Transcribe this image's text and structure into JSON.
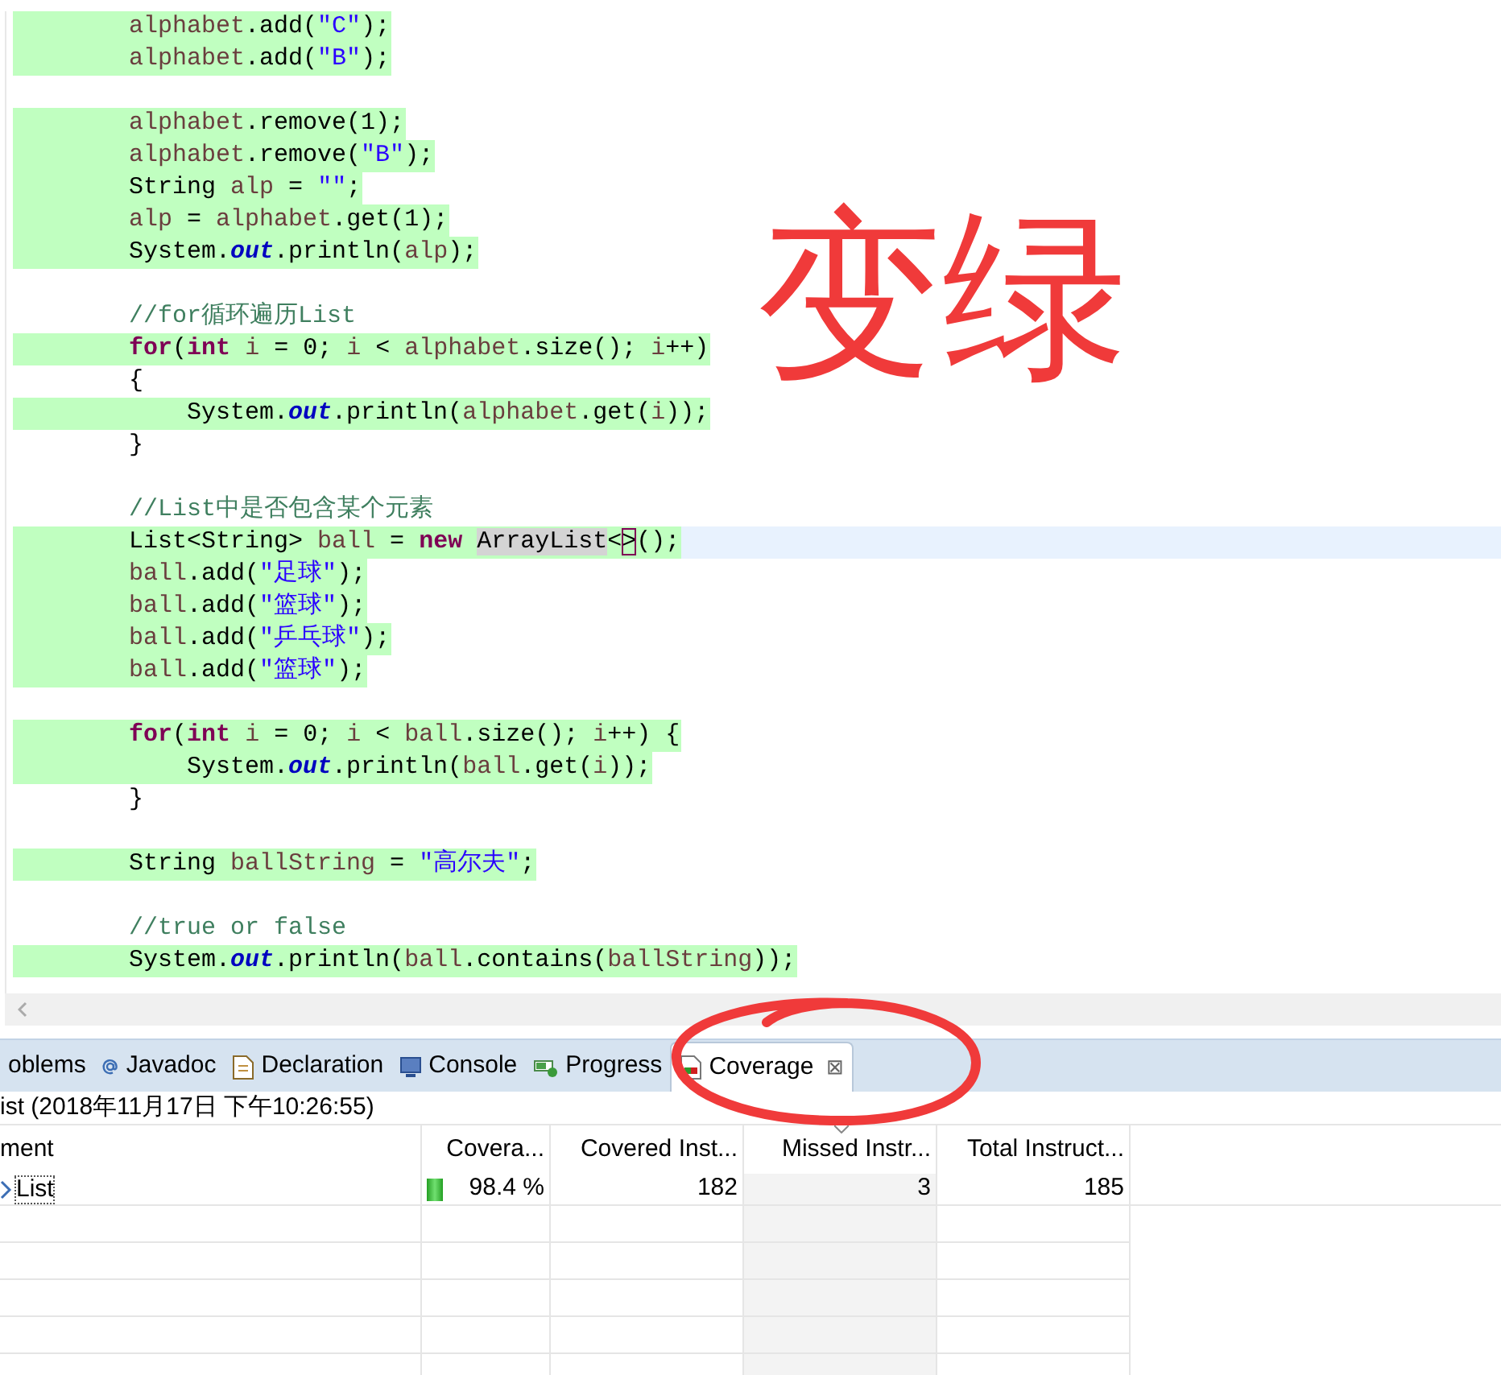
{
  "editor": {
    "lines": [
      {
        "covered": true,
        "tokens": [
          {
            "kind": "var",
            "text": "        alphabet"
          },
          {
            "kind": "plain",
            "text": ".add("
          },
          {
            "kind": "string",
            "text": "\"C\""
          },
          {
            "kind": "plain",
            "text": ");"
          }
        ]
      },
      {
        "covered": true,
        "tokens": [
          {
            "kind": "var",
            "text": "        alphabet"
          },
          {
            "kind": "plain",
            "text": ".add("
          },
          {
            "kind": "string",
            "text": "\"B\""
          },
          {
            "kind": "plain",
            "text": ");"
          }
        ]
      },
      {
        "covered": true,
        "gap_before": true,
        "tokens": [
          {
            "kind": "var",
            "text": "        alphabet"
          },
          {
            "kind": "plain",
            "text": ".remove(1);"
          }
        ]
      },
      {
        "covered": true,
        "tokens": [
          {
            "kind": "var",
            "text": "        alphabet"
          },
          {
            "kind": "plain",
            "text": ".remove("
          },
          {
            "kind": "string",
            "text": "\"B\""
          },
          {
            "kind": "plain",
            "text": ");"
          }
        ]
      },
      {
        "covered": true,
        "tokens": [
          {
            "kind": "plain",
            "text": "        String "
          },
          {
            "kind": "var",
            "text": "alp"
          },
          {
            "kind": "plain",
            "text": " = "
          },
          {
            "kind": "string",
            "text": "\"\""
          },
          {
            "kind": "plain",
            "text": ";"
          }
        ]
      },
      {
        "covered": true,
        "tokens": [
          {
            "kind": "var",
            "text": "        alp"
          },
          {
            "kind": "plain",
            "text": " = "
          },
          {
            "kind": "var",
            "text": "alphabet"
          },
          {
            "kind": "plain",
            "text": ".get(1);"
          }
        ]
      },
      {
        "covered": true,
        "tokens": [
          {
            "kind": "plain",
            "text": "        System."
          },
          {
            "kind": "field",
            "text": "out"
          },
          {
            "kind": "plain",
            "text": ".println("
          },
          {
            "kind": "var",
            "text": "alp"
          },
          {
            "kind": "plain",
            "text": ");"
          }
        ]
      },
      {
        "covered": false,
        "gap_before": true,
        "tokens": [
          {
            "kind": "comment",
            "text": "        //for循环遍历List"
          }
        ]
      },
      {
        "covered": true,
        "tokens": [
          {
            "kind": "keyword",
            "text": "        for"
          },
          {
            "kind": "plain",
            "text": "("
          },
          {
            "kind": "keyword",
            "text": "int"
          },
          {
            "kind": "var",
            "text": " i"
          },
          {
            "kind": "plain",
            "text": " = 0; "
          },
          {
            "kind": "var",
            "text": "i"
          },
          {
            "kind": "plain",
            "text": " < "
          },
          {
            "kind": "var",
            "text": "alphabet"
          },
          {
            "kind": "plain",
            "text": ".size(); "
          },
          {
            "kind": "var",
            "text": "i"
          },
          {
            "kind": "plain",
            "text": "++)"
          }
        ]
      },
      {
        "covered": false,
        "tokens": [
          {
            "kind": "plain",
            "text": "        {"
          }
        ]
      },
      {
        "covered": true,
        "tokens": [
          {
            "kind": "plain",
            "text": "            System."
          },
          {
            "kind": "field",
            "text": "out"
          },
          {
            "kind": "plain",
            "text": ".println("
          },
          {
            "kind": "var",
            "text": "alphabet"
          },
          {
            "kind": "plain",
            "text": ".get("
          },
          {
            "kind": "var",
            "text": "i"
          },
          {
            "kind": "plain",
            "text": "));"
          }
        ]
      },
      {
        "covered": false,
        "tokens": [
          {
            "kind": "plain",
            "text": "        }"
          }
        ]
      },
      {
        "covered": false,
        "gap_before": true,
        "tokens": [
          {
            "kind": "comment",
            "text": "        //List中是否包含某个元素"
          }
        ]
      },
      {
        "covered": true,
        "current": true,
        "tokens": [
          {
            "kind": "plain",
            "text": "        List<String> "
          },
          {
            "kind": "var",
            "text": "ball"
          },
          {
            "kind": "plain",
            "text": " = "
          },
          {
            "kind": "keyword",
            "text": "new "
          },
          {
            "kind": "occurrence",
            "text": "ArrayList"
          },
          {
            "kind": "plain",
            "text": "<"
          },
          {
            "kind": "bracket",
            "text": ">"
          },
          {
            "kind": "plain",
            "text": "();"
          }
        ]
      },
      {
        "covered": true,
        "tokens": [
          {
            "kind": "var",
            "text": "        ball"
          },
          {
            "kind": "plain",
            "text": ".add("
          },
          {
            "kind": "string",
            "text": "\"足球\""
          },
          {
            "kind": "plain",
            "text": ");"
          }
        ]
      },
      {
        "covered": true,
        "tokens": [
          {
            "kind": "var",
            "text": "        ball"
          },
          {
            "kind": "plain",
            "text": ".add("
          },
          {
            "kind": "string",
            "text": "\"篮球\""
          },
          {
            "kind": "plain",
            "text": ");"
          }
        ]
      },
      {
        "covered": true,
        "tokens": [
          {
            "kind": "var",
            "text": "        ball"
          },
          {
            "kind": "plain",
            "text": ".add("
          },
          {
            "kind": "string",
            "text": "\"乒乓球\""
          },
          {
            "kind": "plain",
            "text": ");"
          }
        ]
      },
      {
        "covered": true,
        "tokens": [
          {
            "kind": "var",
            "text": "        ball"
          },
          {
            "kind": "plain",
            "text": ".add("
          },
          {
            "kind": "string",
            "text": "\"篮球\""
          },
          {
            "kind": "plain",
            "text": ");"
          }
        ]
      },
      {
        "covered": true,
        "gap_before": true,
        "tokens": [
          {
            "kind": "keyword",
            "text": "        for"
          },
          {
            "kind": "plain",
            "text": "("
          },
          {
            "kind": "keyword",
            "text": "int"
          },
          {
            "kind": "var",
            "text": " i"
          },
          {
            "kind": "plain",
            "text": " = 0; "
          },
          {
            "kind": "var",
            "text": "i"
          },
          {
            "kind": "plain",
            "text": " < "
          },
          {
            "kind": "var",
            "text": "ball"
          },
          {
            "kind": "plain",
            "text": ".size(); "
          },
          {
            "kind": "var",
            "text": "i"
          },
          {
            "kind": "plain",
            "text": "++) {"
          }
        ]
      },
      {
        "covered": true,
        "tokens": [
          {
            "kind": "plain",
            "text": "            System."
          },
          {
            "kind": "field",
            "text": "out"
          },
          {
            "kind": "plain",
            "text": ".println("
          },
          {
            "kind": "var",
            "text": "ball"
          },
          {
            "kind": "plain",
            "text": ".get("
          },
          {
            "kind": "var",
            "text": "i"
          },
          {
            "kind": "plain",
            "text": "));"
          }
        ]
      },
      {
        "covered": false,
        "tokens": [
          {
            "kind": "plain",
            "text": "        }"
          }
        ]
      },
      {
        "covered": true,
        "gap_before": true,
        "tokens": [
          {
            "kind": "plain",
            "text": "        String "
          },
          {
            "kind": "var",
            "text": "ballString"
          },
          {
            "kind": "plain",
            "text": " = "
          },
          {
            "kind": "string",
            "text": "\"高尔夫\""
          },
          {
            "kind": "plain",
            "text": ";"
          }
        ]
      },
      {
        "covered": false,
        "gap_before": true,
        "tokens": [
          {
            "kind": "comment",
            "text": "        //true or false"
          }
        ]
      },
      {
        "covered": true,
        "tokens": [
          {
            "kind": "plain",
            "text": "        System."
          },
          {
            "kind": "field",
            "text": "out"
          },
          {
            "kind": "plain",
            "text": ".println("
          },
          {
            "kind": "var",
            "text": "ball"
          },
          {
            "kind": "plain",
            "text": ".contains("
          },
          {
            "kind": "var",
            "text": "ballString"
          },
          {
            "kind": "plain",
            "text": "));"
          }
        ]
      }
    ]
  },
  "annotation": {
    "text": "变绿"
  },
  "panel": {
    "tabs": [
      {
        "label": "oblems",
        "kind": "problems",
        "selected": false
      },
      {
        "label": "Javadoc",
        "kind": "javadoc",
        "selected": false
      },
      {
        "label": "Declaration",
        "kind": "declaration",
        "selected": false
      },
      {
        "label": "Console",
        "kind": "console",
        "selected": false
      },
      {
        "label": "Progress",
        "kind": "progress",
        "selected": false
      },
      {
        "label": "Coverage",
        "kind": "coverage",
        "selected": true,
        "close": "⊠"
      }
    ],
    "session": "ist (2018年11月17日 下午10:26:55)",
    "table": {
      "columns": [
        {
          "label": "ment",
          "sorted": false
        },
        {
          "label": "Covera...",
          "sorted": false
        },
        {
          "label": "Covered Inst...",
          "sorted": false
        },
        {
          "label": "Missed Instr...",
          "sorted": true
        },
        {
          "label": "Total Instruct...",
          "sorted": false
        }
      ],
      "rows": [
        {
          "element": "List",
          "level": 0.984,
          "coverage": "98.4 %",
          "covered": "182",
          "missed": "3",
          "total": "185"
        }
      ]
    }
  }
}
